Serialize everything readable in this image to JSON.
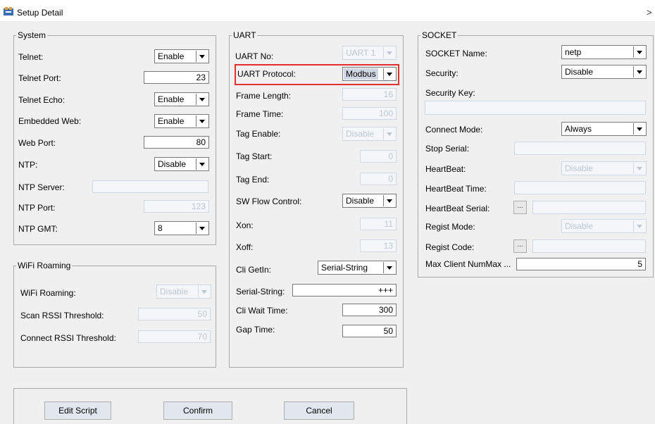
{
  "window": {
    "title": "Setup Detail",
    "icon": "app-setup-icon",
    "chevron": ">"
  },
  "system": {
    "group_title": "System",
    "telnet": {
      "label": "Telnet:",
      "value": "Enable"
    },
    "telnet_port": {
      "label": "Telnet Port:",
      "value": "23"
    },
    "telnet_echo": {
      "label": "Telnet Echo:",
      "value": "Enable"
    },
    "embedded_web": {
      "label": "Embedded Web:",
      "value": "Enable"
    },
    "web_port": {
      "label": "Web Port:",
      "value": "80"
    },
    "ntp": {
      "label": "NTP:",
      "value": "Disable"
    },
    "ntp_server": {
      "label": "NTP Server:",
      "value": ""
    },
    "ntp_port": {
      "label": "NTP Port:",
      "value": "123"
    },
    "ntp_gmt": {
      "label": "NTP GMT:",
      "value": "8"
    }
  },
  "wifi_roaming": {
    "group_title": "WiFi Roaming",
    "roaming": {
      "label": "WiFi Roaming:",
      "value": "Disable"
    },
    "scan_rssi": {
      "label": "Scan RSSI Threshold:",
      "value": "50"
    },
    "connect_rssi": {
      "label": "Connect RSSI Threshold:",
      "value": "70"
    }
  },
  "uart": {
    "group_title": "UART",
    "uart_no": {
      "label": "UART No:",
      "value": "UART 1"
    },
    "protocol": {
      "label": "UART Protocol:",
      "value": "Modbus"
    },
    "frame_length": {
      "label": "Frame Length:",
      "value": "16"
    },
    "frame_time": {
      "label": "Frame Time:",
      "value": "100"
    },
    "tag_enable": {
      "label": "Tag Enable:",
      "value": "Disable"
    },
    "tag_start": {
      "label": "Tag Start:",
      "value": "0"
    },
    "tag_end": {
      "label": "Tag End:",
      "value": "0"
    },
    "sw_flow": {
      "label": "SW Flow Control:",
      "value": "Disable"
    },
    "xon": {
      "label": "Xon:",
      "value": "11"
    },
    "xoff": {
      "label": "Xoff:",
      "value": "13"
    },
    "cli_getin": {
      "label": "Cli GetIn:",
      "value": "Serial-String"
    },
    "serial_string": {
      "label": "Serial-String:",
      "value": "+++"
    },
    "cli_wait": {
      "label": "Cli Wait Time:",
      "value": "300"
    },
    "gap_time": {
      "label": "Gap Time:",
      "value": "50"
    }
  },
  "socket": {
    "group_title": "SOCKET",
    "name": {
      "label": "SOCKET Name:",
      "value": "netp"
    },
    "security": {
      "label": "Security:",
      "value": "Disable"
    },
    "security_key": {
      "label": "Security Key:",
      "value": ""
    },
    "connect_mode": {
      "label": "Connect Mode:",
      "value": "Always"
    },
    "stop_serial": {
      "label": "Stop Serial:",
      "value": ""
    },
    "heartbeat": {
      "label": "HeartBeat:",
      "value": "Disable"
    },
    "heartbeat_time": {
      "label": "HeartBeat Time:",
      "value": ""
    },
    "heartbeat_serial": {
      "label": "HeartBeat Serial:",
      "button": "...",
      "value": ""
    },
    "regist_mode": {
      "label": "Regist Mode:",
      "value": "Disable"
    },
    "regist_code": {
      "label": "Regist Code:",
      "button": "...",
      "value": ""
    },
    "max_client": {
      "label": "Max Client NumMax ...",
      "value": "5"
    }
  },
  "buttons": {
    "edit_script": "Edit Script",
    "confirm": "Confirm",
    "cancel": "Cancel"
  },
  "colors": {
    "highlight": "#e03030",
    "disabled_text": "#bcc6d4",
    "button_face": "#e1e6ef"
  }
}
